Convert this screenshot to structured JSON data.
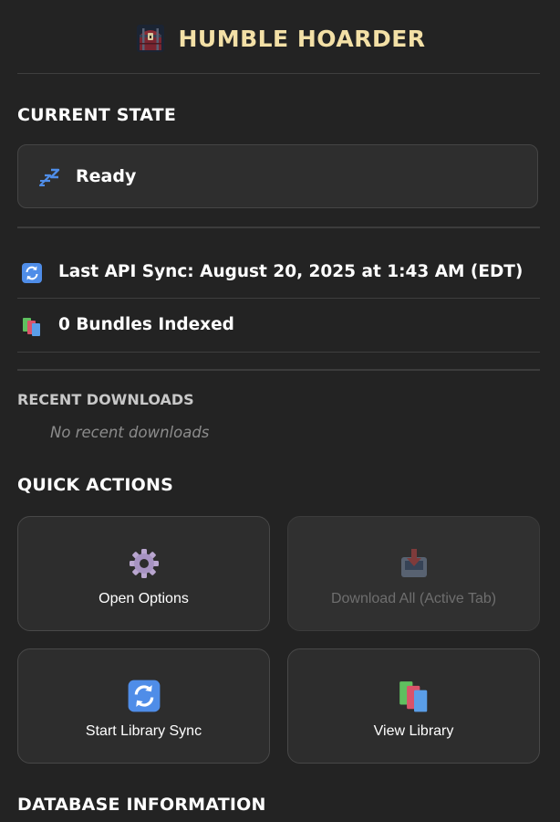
{
  "header": {
    "title": "HUMBLE HOARDER",
    "logo_icon": "treasure-chest-icon"
  },
  "current_state": {
    "section_title": "CURRENT STATE",
    "status_text": "Ready",
    "status_icon": "sleeping-zzz-icon",
    "status_icon_color": "#4f8de8"
  },
  "info": {
    "last_sync": "Last API Sync: August 20, 2025 at 1:43 AM (EDT)",
    "last_sync_icon": "sync-arrows-icon",
    "bundles": "0 Bundles Indexed",
    "bundles_icon": "books-stack-icon"
  },
  "recent_downloads": {
    "section_title": "RECENT DOWNLOADS",
    "empty_text": "No recent downloads"
  },
  "quick_actions": {
    "section_title": "QUICK ACTIONS",
    "open_options": {
      "label": "Open Options",
      "icon": "gear-icon",
      "enabled": true
    },
    "download_all": {
      "label": "Download All (Active Tab)",
      "icon": "inbox-download-icon",
      "enabled": false
    },
    "start_sync": {
      "label": "Start Library Sync",
      "icon": "sync-arrows-icon",
      "enabled": true
    },
    "view_library": {
      "label": "View Library",
      "icon": "books-stack-icon",
      "enabled": true
    }
  },
  "database": {
    "section_title": "DATABASE INFORMATION"
  },
  "colors": {
    "background": "#232323",
    "title_gold": "#f3e0a6",
    "card_bg": "#2d2d2d",
    "sync_blue": "#4f8de8"
  }
}
